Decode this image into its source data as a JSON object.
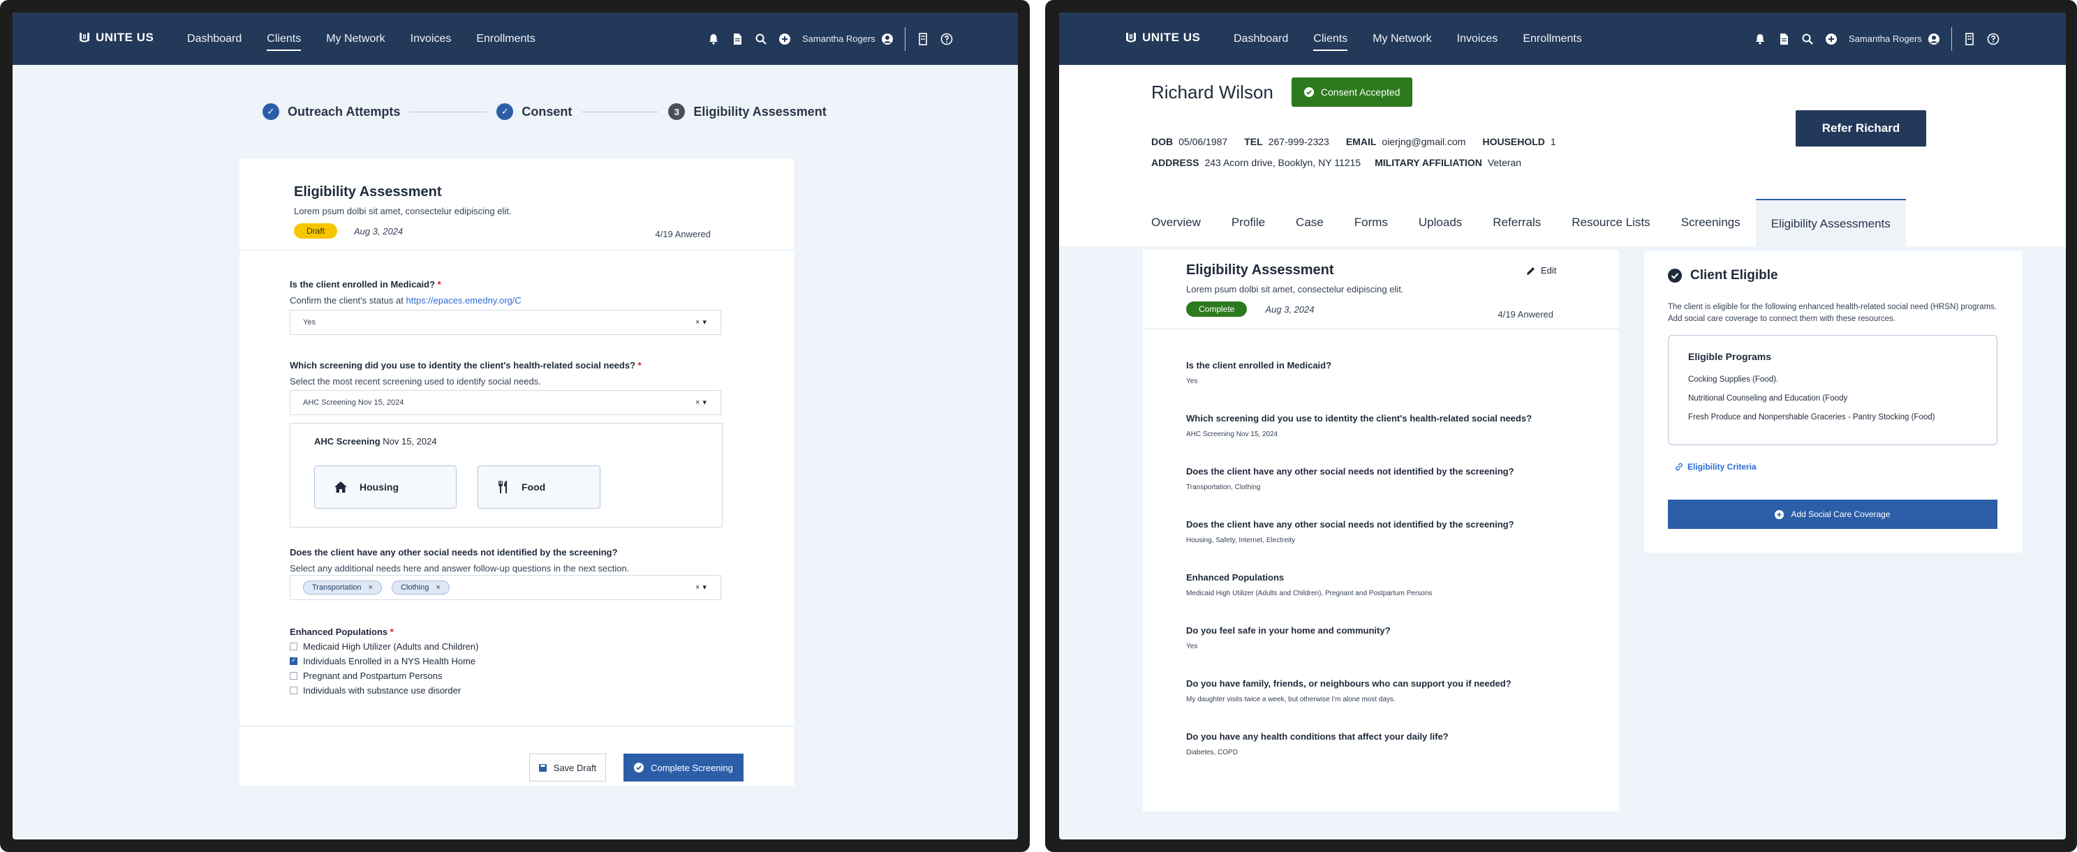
{
  "nav": {
    "logo": "UNITE US",
    "links": [
      "Dashboard",
      "Clients",
      "My Network",
      "Invoices",
      "Enrollments"
    ],
    "active": "Clients",
    "user": "Samantha Rogers"
  },
  "left": {
    "stepper": {
      "steps": [
        {
          "label": "Outreach Attempts",
          "state": "done"
        },
        {
          "label": "Consent",
          "state": "done"
        },
        {
          "label": "Eligibility Assessment",
          "state": "current",
          "number": "3"
        }
      ]
    },
    "header": {
      "title": "Eligibility Assessment",
      "subtitle": "Lorem psum dolbi sit amet, consectelur edipiscing elit.",
      "status": "Draft",
      "date": "Aug 3, 2024",
      "count": "4/19 Anwered"
    },
    "q1": {
      "label": "Is the client enrolled in Medicaid?",
      "required": "*",
      "help_prefix": "Confirm the client's status at",
      "help_link": "https://epaces.emedny.org/C",
      "value": "Yes"
    },
    "q2": {
      "label": "Which screening did you use to identity the client's health-related social needs?",
      "required": "*",
      "help": "Select the most recent screening used to identify social needs.",
      "value": "AHC Screening Nov 15, 2024",
      "detail_title": "AHC Screening",
      "detail_date": "Nov 15, 2024",
      "needs": [
        "Housing",
        "Food"
      ]
    },
    "q3": {
      "label": "Does the client have any other social needs not identified by the screening?",
      "help": "Select any additional needs here and answer follow-up questions in the next section.",
      "chips": [
        "Transportation",
        "Clothing"
      ]
    },
    "q4": {
      "label": "Enhanced Populations",
      "required": "*",
      "options": [
        {
          "label": "Medicaid High Utilizer (Adults and Children)",
          "checked": false
        },
        {
          "label": "Individuals Enrolled in a NYS Health Home",
          "checked": true
        },
        {
          "label": "Pregnant and Postpartum Persons",
          "checked": false
        },
        {
          "label": "Individuals with substance use disorder",
          "checked": false
        }
      ]
    },
    "actions": {
      "save": "Save Draft",
      "complete": "Complete Screening"
    },
    "select_clear": "×",
    "select_caret": "▾"
  },
  "right": {
    "client": {
      "name": "Richard Wilson",
      "consent": "Consent Accepted",
      "dob_label": "DOB",
      "dob": "05/06/1987",
      "tel_label": "TEL",
      "tel": "267-999-2323",
      "email_label": "EMAIL",
      "email": "oierjng@gmail.com",
      "household_label": "HOUSEHOLD",
      "household": "1",
      "address_label": "ADDRESS",
      "address": "243 Acorn drive, Booklyn, NY 11215",
      "military_label": "MILITARY AFFILIATION",
      "military": "Veteran",
      "refer": "Refer Richard"
    },
    "tabs": [
      "Overview",
      "Profile",
      "Case",
      "Forms",
      "Uploads",
      "Referrals",
      "Resource Lists",
      "Screenings",
      "Eligibility Assessments"
    ],
    "active_tab": "Eligibility Assessments",
    "header": {
      "title": "Eligibility Assessment",
      "subtitle": "Lorem psum dolbi sit amet, consectelur edipiscing elit.",
      "status": "Complete",
      "date": "Aug 3, 2024",
      "count": "4/19 Anwered",
      "edit": "Edit"
    },
    "answers": [
      {
        "q": "Is the client enrolled in Medicaid?",
        "a": "Yes"
      },
      {
        "q": "Which screening did you use to identity the client's health-related social needs?",
        "a": "AHC Screening Nov 15, 2024"
      },
      {
        "q": "Does the client have any other social needs not identified by the screening?",
        "a": "Transportation, Clothing"
      },
      {
        "q": "Does the client have any other social needs not identified by the screening?",
        "a": "Housing, Safety, Internet, Electreity"
      },
      {
        "q": "Enhanced Populations",
        "a": "Medicaid High Utilizer (Adults and Children),  Pregnant and Postpartum Persons"
      },
      {
        "q": "Do you feel safe in your home and community?",
        "a": "Yes"
      },
      {
        "q": "Do you have family, friends, or neighbours who can support you if needed?",
        "a": "My daughter visits twice a week, but otherwise I'm alone most days."
      },
      {
        "q": "Do you have any health conditions that affect your daily life?",
        "a": "Diabetes, COPD"
      }
    ],
    "eligible": {
      "title": "Client Eligible",
      "desc": "The client is eligible for the following enhanced health-related social need (HRSN) programs. Add social care coverage to connect them with these resources.",
      "programs_title": "Eligible Programs",
      "programs": [
        "Cocking Supplies (Food).",
        "Nutritional Counseling and Education (Foody",
        "Fresh Produce and Nonpershable Graceries - Pantry Stocking (Food)"
      ],
      "criteria": "Eligibility Criteria",
      "add": "Add Social Care Coverage"
    }
  },
  "colors": {
    "nav": "#23395a",
    "primary": "#2c5ea8",
    "success": "#2c7a1d",
    "draft": "#f7c600",
    "background": "#eef4fa"
  }
}
